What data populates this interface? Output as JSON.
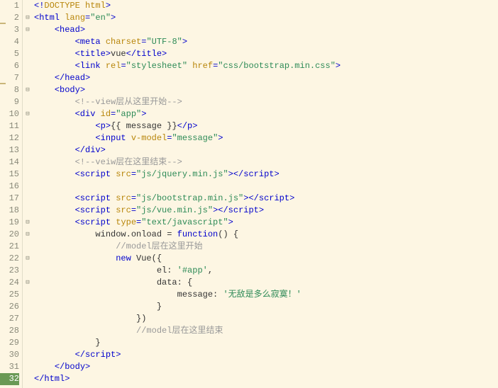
{
  "gutter": {
    "lines": [
      {
        "n": "1",
        "mark": false,
        "curr": false,
        "fold": ""
      },
      {
        "n": "2",
        "mark": true,
        "curr": false,
        "fold": "⊟"
      },
      {
        "n": "3",
        "mark": false,
        "curr": false,
        "fold": "⊟"
      },
      {
        "n": "4",
        "mark": false,
        "curr": false,
        "fold": ""
      },
      {
        "n": "5",
        "mark": false,
        "curr": false,
        "fold": ""
      },
      {
        "n": "6",
        "mark": false,
        "curr": false,
        "fold": ""
      },
      {
        "n": "7",
        "mark": true,
        "curr": false,
        "fold": ""
      },
      {
        "n": "8",
        "mark": false,
        "curr": false,
        "fold": "⊟"
      },
      {
        "n": "9",
        "mark": false,
        "curr": false,
        "fold": ""
      },
      {
        "n": "10",
        "mark": false,
        "curr": false,
        "fold": "⊟"
      },
      {
        "n": "11",
        "mark": false,
        "curr": false,
        "fold": ""
      },
      {
        "n": "12",
        "mark": false,
        "curr": false,
        "fold": ""
      },
      {
        "n": "13",
        "mark": false,
        "curr": false,
        "fold": ""
      },
      {
        "n": "14",
        "mark": false,
        "curr": false,
        "fold": ""
      },
      {
        "n": "15",
        "mark": false,
        "curr": false,
        "fold": ""
      },
      {
        "n": "16",
        "mark": false,
        "curr": false,
        "fold": ""
      },
      {
        "n": "17",
        "mark": false,
        "curr": false,
        "fold": ""
      },
      {
        "n": "18",
        "mark": false,
        "curr": false,
        "fold": ""
      },
      {
        "n": "19",
        "mark": false,
        "curr": false,
        "fold": "⊟"
      },
      {
        "n": "20",
        "mark": false,
        "curr": false,
        "fold": "⊟"
      },
      {
        "n": "21",
        "mark": false,
        "curr": false,
        "fold": ""
      },
      {
        "n": "22",
        "mark": false,
        "curr": false,
        "fold": "⊟"
      },
      {
        "n": "23",
        "mark": false,
        "curr": false,
        "fold": ""
      },
      {
        "n": "24",
        "mark": false,
        "curr": false,
        "fold": "⊟"
      },
      {
        "n": "25",
        "mark": false,
        "curr": false,
        "fold": ""
      },
      {
        "n": "26",
        "mark": false,
        "curr": false,
        "fold": ""
      },
      {
        "n": "27",
        "mark": false,
        "curr": false,
        "fold": ""
      },
      {
        "n": "28",
        "mark": false,
        "curr": false,
        "fold": ""
      },
      {
        "n": "29",
        "mark": false,
        "curr": false,
        "fold": ""
      },
      {
        "n": "30",
        "mark": false,
        "curr": false,
        "fold": ""
      },
      {
        "n": "31",
        "mark": false,
        "curr": false,
        "fold": ""
      },
      {
        "n": "32",
        "mark": false,
        "curr": true,
        "fold": ""
      }
    ]
  },
  "code": [
    [
      {
        "c": "tag",
        "t": "<!"
      },
      {
        "c": "attr",
        "t": "DOCTYPE"
      },
      {
        "c": "tag",
        "t": " "
      },
      {
        "c": "attr",
        "t": "html"
      },
      {
        "c": "tag",
        "t": ">"
      }
    ],
    [
      {
        "c": "tag",
        "t": "<html "
      },
      {
        "c": "attr",
        "t": "lang"
      },
      {
        "c": "tag",
        "t": "="
      },
      {
        "c": "str",
        "t": "\"en\""
      },
      {
        "c": "tag",
        "t": ">"
      }
    ],
    [
      {
        "c": "txt",
        "t": "    "
      },
      {
        "c": "tag",
        "t": "<head>"
      }
    ],
    [
      {
        "c": "txt",
        "t": "        "
      },
      {
        "c": "tag",
        "t": "<meta "
      },
      {
        "c": "attr",
        "t": "charset"
      },
      {
        "c": "tag",
        "t": "="
      },
      {
        "c": "str",
        "t": "\"UTF-8\""
      },
      {
        "c": "tag",
        "t": ">"
      }
    ],
    [
      {
        "c": "txt",
        "t": "        "
      },
      {
        "c": "tag",
        "t": "<title>"
      },
      {
        "c": "txt",
        "t": "vue"
      },
      {
        "c": "tag",
        "t": "</title>"
      }
    ],
    [
      {
        "c": "txt",
        "t": "        "
      },
      {
        "c": "tag",
        "t": "<link "
      },
      {
        "c": "attr",
        "t": "rel"
      },
      {
        "c": "tag",
        "t": "="
      },
      {
        "c": "str",
        "t": "\"stylesheet\""
      },
      {
        "c": "tag",
        "t": " "
      },
      {
        "c": "attr",
        "t": "href"
      },
      {
        "c": "tag",
        "t": "="
      },
      {
        "c": "str",
        "t": "\"css/bootstrap.min.css\""
      },
      {
        "c": "tag",
        "t": ">"
      }
    ],
    [
      {
        "c": "txt",
        "t": "    "
      },
      {
        "c": "tag",
        "t": "</head>"
      }
    ],
    [
      {
        "c": "txt",
        "t": "    "
      },
      {
        "c": "tag",
        "t": "<body>"
      }
    ],
    [
      {
        "c": "txt",
        "t": "        "
      },
      {
        "c": "com",
        "t": "<!--view层从这里开始-->"
      }
    ],
    [
      {
        "c": "txt",
        "t": "        "
      },
      {
        "c": "tag",
        "t": "<div "
      },
      {
        "c": "attr",
        "t": "id"
      },
      {
        "c": "tag",
        "t": "="
      },
      {
        "c": "str",
        "t": "\"app\""
      },
      {
        "c": "tag",
        "t": ">"
      }
    ],
    [
      {
        "c": "txt",
        "t": "            "
      },
      {
        "c": "tag",
        "t": "<p>"
      },
      {
        "c": "txt",
        "t": "{{ message }}"
      },
      {
        "c": "tag",
        "t": "</p>"
      }
    ],
    [
      {
        "c": "txt",
        "t": "            "
      },
      {
        "c": "tag",
        "t": "<input "
      },
      {
        "c": "attr",
        "t": "v-model"
      },
      {
        "c": "tag",
        "t": "="
      },
      {
        "c": "str",
        "t": "\"message\""
      },
      {
        "c": "tag",
        "t": ">"
      }
    ],
    [
      {
        "c": "txt",
        "t": "        "
      },
      {
        "c": "tag",
        "t": "</div>"
      }
    ],
    [
      {
        "c": "txt",
        "t": "        "
      },
      {
        "c": "com",
        "t": "<!--veiw层在这里结束-->"
      }
    ],
    [
      {
        "c": "txt",
        "t": "        "
      },
      {
        "c": "tag",
        "t": "<script "
      },
      {
        "c": "attr",
        "t": "src"
      },
      {
        "c": "tag",
        "t": "="
      },
      {
        "c": "str",
        "t": "\"js/jquery.min.js\""
      },
      {
        "c": "tag",
        "t": "></"
      },
      {
        "c": "tag",
        "t": "script>"
      }
    ],
    [],
    [
      {
        "c": "txt",
        "t": "        "
      },
      {
        "c": "tag",
        "t": "<script "
      },
      {
        "c": "attr",
        "t": "src"
      },
      {
        "c": "tag",
        "t": "="
      },
      {
        "c": "str",
        "t": "\"js/bootstrap.min.js\""
      },
      {
        "c": "tag",
        "t": "></"
      },
      {
        "c": "tag",
        "t": "script>"
      }
    ],
    [
      {
        "c": "txt",
        "t": "        "
      },
      {
        "c": "tag",
        "t": "<script "
      },
      {
        "c": "attr",
        "t": "src"
      },
      {
        "c": "tag",
        "t": "="
      },
      {
        "c": "str",
        "t": "\"js/vue.min.js\""
      },
      {
        "c": "tag",
        "t": "></"
      },
      {
        "c": "tag",
        "t": "script>"
      }
    ],
    [
      {
        "c": "txt",
        "t": "        "
      },
      {
        "c": "tag",
        "t": "<script "
      },
      {
        "c": "attr",
        "t": "type"
      },
      {
        "c": "tag",
        "t": "="
      },
      {
        "c": "str",
        "t": "\"text/javascript\""
      },
      {
        "c": "tag",
        "t": ">"
      }
    ],
    [
      {
        "c": "txt",
        "t": "            window.onload = "
      },
      {
        "c": "kw",
        "t": "function"
      },
      {
        "c": "txt",
        "t": "() {"
      }
    ],
    [
      {
        "c": "txt",
        "t": "                "
      },
      {
        "c": "com",
        "t": "//model层在这里开始"
      }
    ],
    [
      {
        "c": "txt",
        "t": "                "
      },
      {
        "c": "kw",
        "t": "new"
      },
      {
        "c": "txt",
        "t": " Vue({"
      }
    ],
    [
      {
        "c": "txt",
        "t": "                        el: "
      },
      {
        "c": "str",
        "t": "'#app'"
      },
      {
        "c": "txt",
        "t": ","
      }
    ],
    [
      {
        "c": "txt",
        "t": "                        data: {"
      }
    ],
    [
      {
        "c": "txt",
        "t": "                            message: "
      },
      {
        "c": "str",
        "t": "'无敌是多么寂寞！'"
      }
    ],
    [
      {
        "c": "txt",
        "t": "                        }"
      }
    ],
    [
      {
        "c": "txt",
        "t": "                    })"
      }
    ],
    [
      {
        "c": "txt",
        "t": "                    "
      },
      {
        "c": "com",
        "t": "//model层在这里结束"
      }
    ],
    [
      {
        "c": "txt",
        "t": "            }"
      }
    ],
    [
      {
        "c": "txt",
        "t": "        "
      },
      {
        "c": "tag",
        "t": "</"
      },
      {
        "c": "tag",
        "t": "script>"
      }
    ],
    [
      {
        "c": "txt",
        "t": "    "
      },
      {
        "c": "tag",
        "t": "</body>"
      }
    ],
    [
      {
        "c": "tag",
        "t": "</html>"
      }
    ]
  ]
}
